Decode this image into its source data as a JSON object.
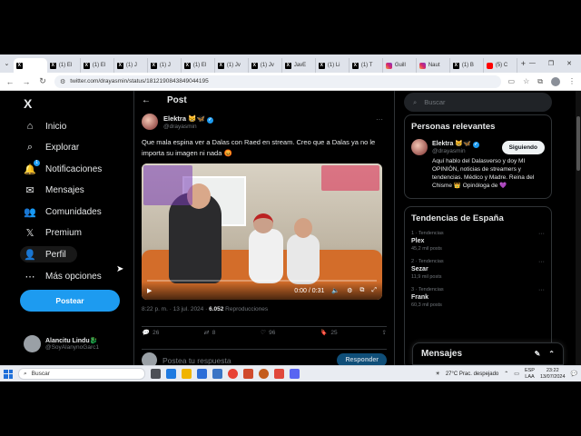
{
  "browser": {
    "tabs": [
      {
        "label": "",
        "icon": "x",
        "active": true
      },
      {
        "label": "(1) El",
        "icon": "x"
      },
      {
        "label": "(1) El",
        "icon": "x"
      },
      {
        "label": "(1) J",
        "icon": "x"
      },
      {
        "label": "(1) J",
        "icon": "x"
      },
      {
        "label": "(1) El",
        "icon": "x"
      },
      {
        "label": "(1) Jv",
        "icon": "x"
      },
      {
        "label": "(1) Jv",
        "icon": "x"
      },
      {
        "label": "JavE",
        "icon": "x"
      },
      {
        "label": "(1) Li",
        "icon": "x"
      },
      {
        "label": "(1) T",
        "icon": "x"
      },
      {
        "label": "Guill",
        "icon": "ig"
      },
      {
        "label": "Naut",
        "icon": "ig"
      },
      {
        "label": "(1) B",
        "icon": "x"
      },
      {
        "label": "(5) C",
        "icon": "yt"
      }
    ],
    "url": "twitter.com/drayasmin/status/1812190843849044195"
  },
  "nav": {
    "logo": "X",
    "items": [
      {
        "label": "Inicio",
        "icon": "⌂",
        "name": "home"
      },
      {
        "label": "Explorar",
        "icon": "⌕",
        "name": "explore"
      },
      {
        "label": "Notificaciones",
        "icon": "🔔",
        "name": "notifications",
        "badge": "1"
      },
      {
        "label": "Mensajes",
        "icon": "✉",
        "name": "messages"
      },
      {
        "label": "Comunidades",
        "icon": "👥",
        "name": "communities"
      },
      {
        "label": "Premium",
        "icon": "𝕏",
        "name": "premium"
      },
      {
        "label": "Perfil",
        "icon": "👤",
        "name": "profile"
      },
      {
        "label": "Más opciones",
        "icon": "⋯",
        "name": "more-options"
      }
    ],
    "post_label": "Postear",
    "account": {
      "name": "Alancitu Lindu🐉",
      "handle": "@SoyAlanynoGarc1"
    }
  },
  "post": {
    "header": "Post",
    "author_name": "Elektra 😸🦋",
    "author_handle": "@drayasmin",
    "text": "Que mala espina ver a Dalas con Raed en stream. Creo que a Dalas ya no le importa su imagen ni nada 😡",
    "video_time": "0:00 / 0:31",
    "video_progress": 0,
    "time": "8:22 p. m. · 13 jul. 2024 · ",
    "views": "6.052",
    "views_label": " Reproducciones",
    "replies": "26",
    "reposts": "8",
    "likes": "96",
    "bookmarks": "25",
    "reply_placeholder": "Postea tu respuesta",
    "reply_button": "Responder"
  },
  "sidebar": {
    "search_placeholder": "Buscar",
    "relevant_title": "Personas relevantes",
    "relevant_user": {
      "name": "Elektra 😸🦋",
      "handle": "@drayasmin",
      "follow_label": "Siguiendo",
      "bio": "Aquí hablo del Dalasverso y doy MI OPINIÓN, noticias de streamers y tendencias. Médico y Madre. Reina del Chisme 👑 Opinóloga de 💜"
    },
    "trends_title": "Tendencias de España",
    "trends": [
      {
        "category": "1 · Tendencias",
        "name": "Plex",
        "count": "45,2 mil posts"
      },
      {
        "category": "2 · Tendencias",
        "name": "Sezar",
        "count": "11,9 mil posts"
      },
      {
        "category": "3 · Tendencias",
        "name": "Frank",
        "count": "60,3 mil posts"
      }
    ],
    "messages_label": "Mensajes"
  },
  "taskbar": {
    "search_placeholder": "Buscar",
    "weather": "27°C  Prac. despejado",
    "lang_top": "ESP",
    "lang_bottom": "LAA",
    "time": "23:22",
    "date": "13/07/2024"
  },
  "colors": {
    "accent": "#1d9bf0",
    "background": "#000000"
  }
}
